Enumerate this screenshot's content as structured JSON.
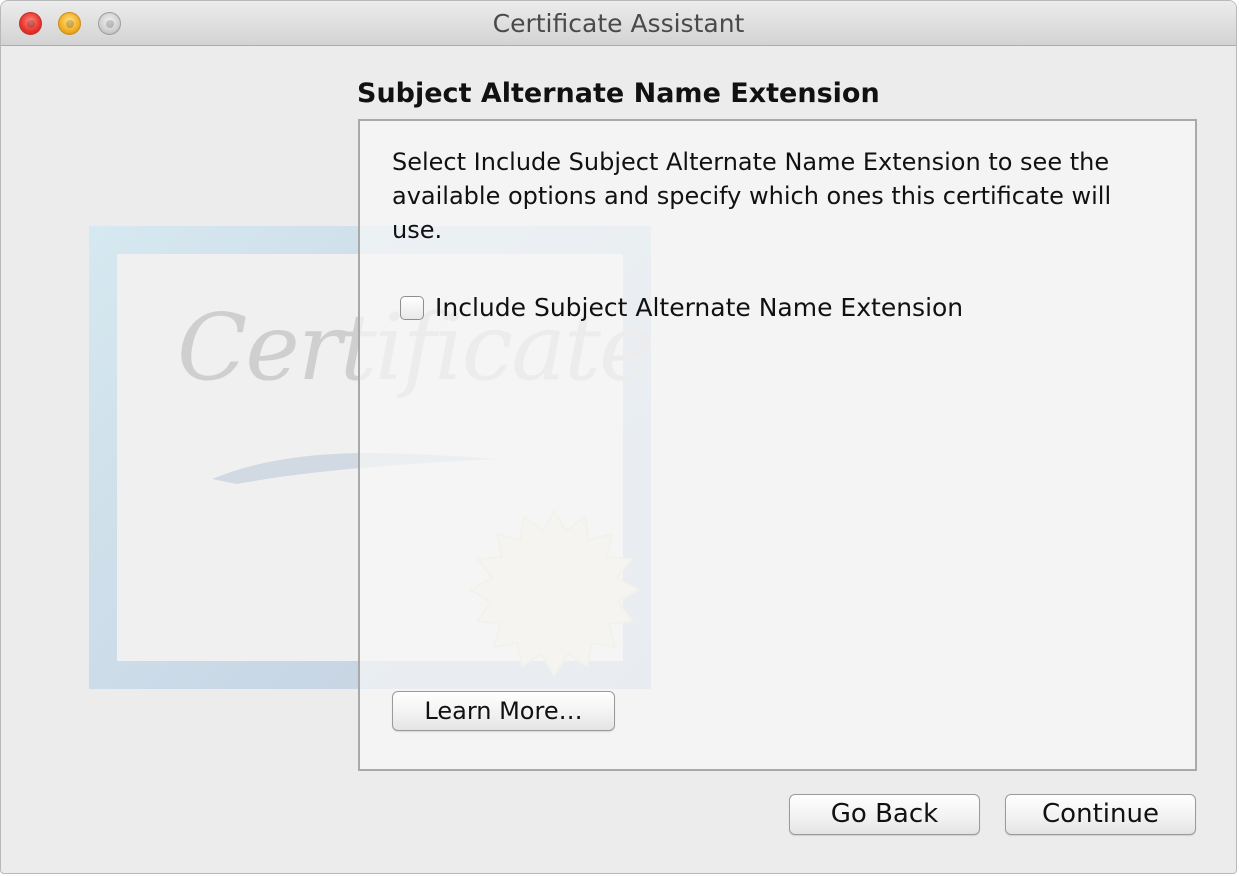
{
  "window": {
    "title": "Certificate Assistant",
    "controls": [
      "close",
      "minimize",
      "zoom"
    ]
  },
  "certificate_graphic": {
    "script_text": "Certificate"
  },
  "page": {
    "heading": "Subject Alternate Name Extension",
    "description": "Select Include Subject Alternate Name Extension to see the available options and specify which ones this certificate will use.",
    "checkbox": {
      "label": "Include Subject Alternate Name Extension",
      "checked": false
    },
    "learn_more_label": "Learn More…"
  },
  "footer": {
    "go_back_label": "Go Back",
    "continue_label": "Continue"
  }
}
